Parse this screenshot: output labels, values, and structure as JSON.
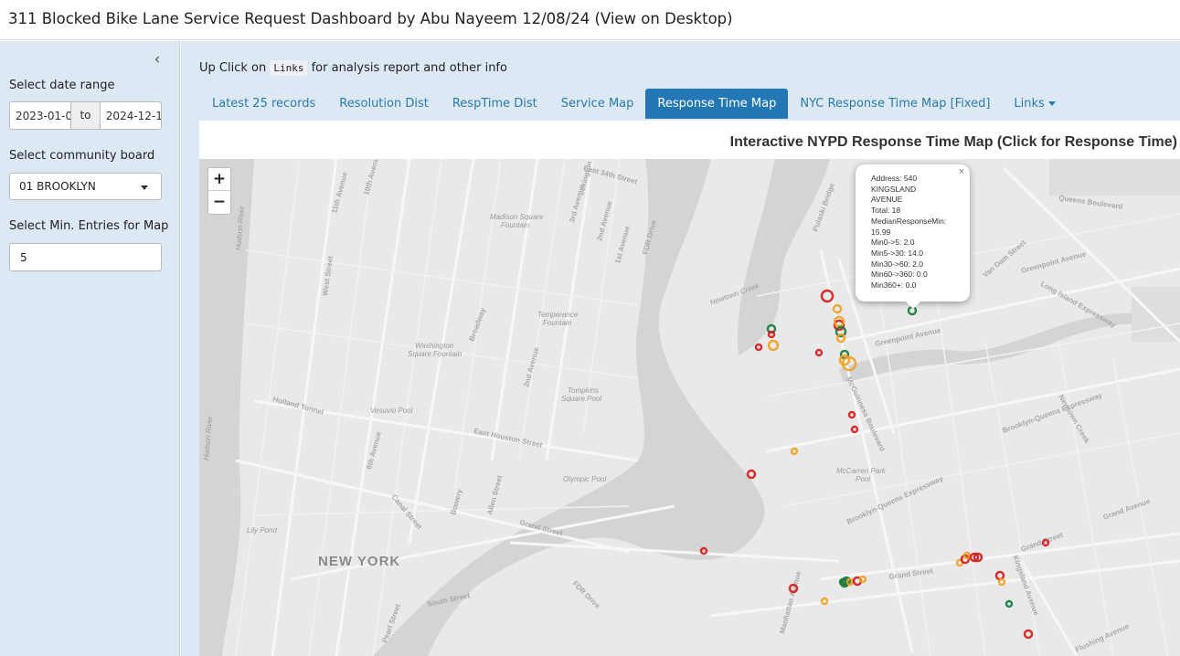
{
  "app": {
    "title": "311 Blocked Bike Lane Service Request Dashboard by Abu Nayeem 12/08/24 (View on Desktop)"
  },
  "sidebar": {
    "collapse_glyph": "‹",
    "date_label": "Select date range",
    "date_start": "2023-01-0",
    "date_to": "to",
    "date_end": "2024-12-1",
    "board_label": "Select community board",
    "board_value": "01 BROOKLYN",
    "min_label": "Select Min. Entries for Map",
    "min_value": "5"
  },
  "main": {
    "note_prefix": "Up Click on",
    "note_code": "Links",
    "note_suffix": "for analysis report and other info",
    "tabs": [
      {
        "label": "Latest 25 records"
      },
      {
        "label": "Resolution Dist"
      },
      {
        "label": "RespTime Dist"
      },
      {
        "label": "Service Map"
      },
      {
        "label": "Response Time Map",
        "active": true
      },
      {
        "label": "NYC Response Time Map [Fixed]"
      },
      {
        "label": "Links"
      }
    ]
  },
  "map": {
    "title": "Interactive NYPD Response Time Map (Click for Response Time)",
    "zoom_in": "+",
    "zoom_out": "−",
    "city_label": "NEW YORK",
    "popup": {
      "close": "×",
      "lines": [
        "Address: 540",
        "KINGSLAND",
        "AVENUE",
        "Total: 18",
        "MedianResponseMin:",
        "15.99",
        "Min0->5: 2.0",
        "Min5->30: 14.0",
        "Min30->60: 2.0",
        "Min60->360: 0.0",
        "Min360+: 0.0"
      ]
    },
    "colors": {
      "red": "#d7191c",
      "orange": "#f0a020",
      "green": "#1a7a3a",
      "water": "#d4d4d4",
      "land": "#e9e9e9",
      "road": "#f7f7f7"
    }
  },
  "labels": {
    "places": [
      "Madison Square",
      "Fountain",
      "Temperance",
      "Fountain",
      "Washington",
      "Square Fountain",
      "Tompkins",
      "Square Pool",
      "Vesuvio Pool",
      "Olympic Pool",
      "McCarren Park",
      "Pool",
      "Lily Pond",
      "Hudson River",
      "Hudson River",
      "Newtown Creek"
    ],
    "streets": [
      "East 34th Street",
      "11th Avenue",
      "10th Avenue",
      "3rd Avenue",
      "2nd Avenue",
      "1st Avenue",
      "FDR Drive",
      "Lexington Avenue",
      "Broadway",
      "2nd Avenue",
      "Holland Tunnel",
      "West Street",
      "6th Avenue",
      "East Houston Street",
      "Grand Street",
      "Bowery",
      "Allen Street",
      "Canal Street",
      "FDR Drive",
      "South Street",
      "Pearl Street",
      "Pulaski Bridge",
      "Greenpoint Avenue",
      "Queens Boulevard",
      "Van Dam Street",
      "Long Island Expressway",
      "Greenpoint Avenue",
      "Brooklyn-Queens Expressway",
      "Manhattan Avenue",
      "Grand Street",
      "Grand Avenue",
      "Flushing Avenue",
      "Grand Street",
      "Kingsland Avenue",
      "McGuinness Boulevard",
      "Newtown Creek",
      "Brooklyn-Queens Expressway"
    ]
  }
}
